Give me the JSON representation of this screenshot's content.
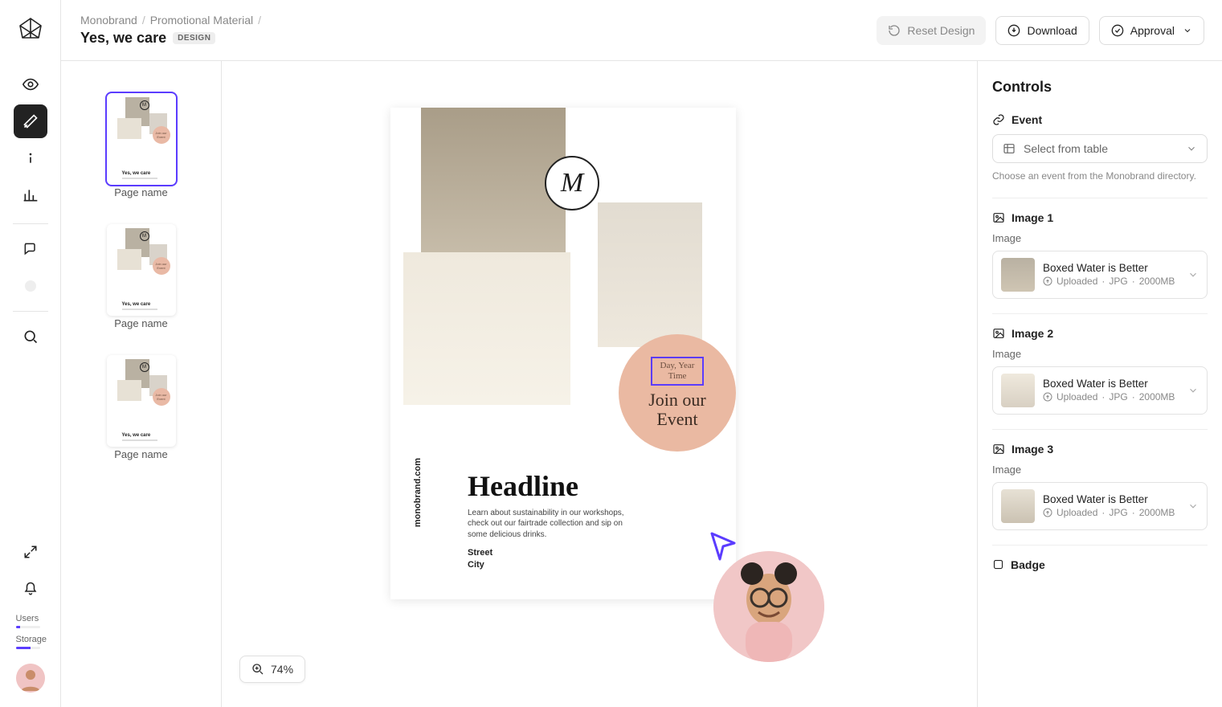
{
  "breadcrumb": [
    "Monobrand",
    "Promotional Material"
  ],
  "title": "Yes, we care",
  "title_badge": "DESIGN",
  "header_buttons": {
    "reset": "Reset Design",
    "download": "Download",
    "approval": "Approval"
  },
  "pages": [
    {
      "label": "Page name",
      "selected": true
    },
    {
      "label": "Page name",
      "selected": false
    },
    {
      "label": "Page name",
      "selected": false
    }
  ],
  "zoom": "74%",
  "artboard": {
    "logo_letter": "M",
    "date_line1": "Day, Year",
    "date_line2": "Time",
    "join_line1": "Join our",
    "join_line2": "Event",
    "url": "monobrand.com",
    "headline": "Headline",
    "description": "Learn about sustainability in our workshops, check out our fairtrade collection and sip on some delicious drinks.",
    "street": "Street",
    "city": "City"
  },
  "controls": {
    "title": "Controls",
    "event": {
      "label": "Event",
      "placeholder": "Select from table",
      "help": "Choose an event from the Monobrand directory."
    },
    "images": [
      {
        "label": "Image 1",
        "sub": "Image",
        "name": "Boxed Water is Better",
        "status": "Uploaded",
        "format": "JPG",
        "size": "2000MB"
      },
      {
        "label": "Image 2",
        "sub": "Image",
        "name": "Boxed Water is Better",
        "status": "Uploaded",
        "format": "JPG",
        "size": "2000MB"
      },
      {
        "label": "Image 3",
        "sub": "Image",
        "name": "Boxed Water is Better",
        "status": "Uploaded",
        "format": "JPG",
        "size": "2000MB"
      }
    ],
    "badge_label": "Badge"
  },
  "sidebar_meters": {
    "users_label": "Users",
    "users_pct": 18,
    "storage_label": "Storage",
    "storage_pct": 62
  }
}
